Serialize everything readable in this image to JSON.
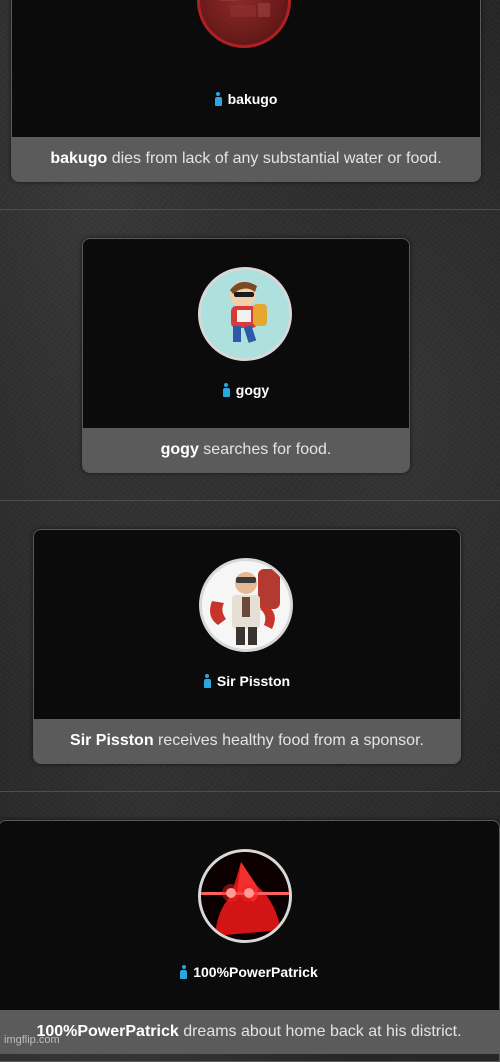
{
  "events": [
    {
      "name": "bakugo",
      "action": "dies from lack of any substantial water or food."
    },
    {
      "name": "gogy",
      "action": "searches for food."
    },
    {
      "name": "Sir Pisston",
      "action": "receives healthy food from a sponsor."
    },
    {
      "name": "100%PowerPatrick",
      "action": "dreams about home back at his district."
    }
  ],
  "watermark": "imgflip.com",
  "colors": {
    "gender_icon": "#29a8e0",
    "card_top": "#0b0b0c",
    "card_bottom": "#5b5b5b"
  },
  "icons": {
    "gender": "person-male-icon"
  }
}
